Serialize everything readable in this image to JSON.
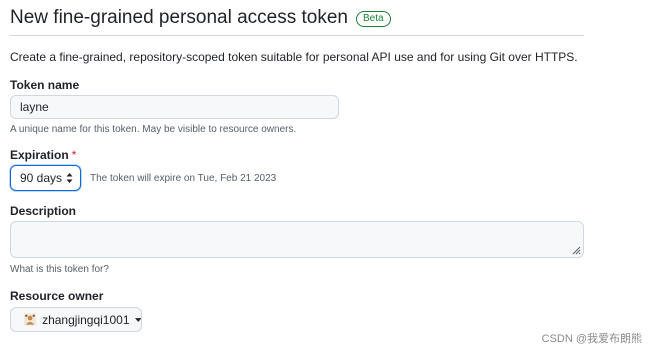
{
  "header": {
    "title": "New fine-grained personal access token",
    "badge": "Beta"
  },
  "intro": "Create a fine-grained, repository-scoped token suitable for personal API use and for using Git over HTTPS.",
  "token_name": {
    "label": "Token name",
    "value": "layne",
    "note": "A unique name for this token. May be visible to resource owners."
  },
  "expiration": {
    "label": "Expiration",
    "required_mark": "*",
    "selected": "90 days",
    "note": "The token will expire on Tue, Feb 21 2023"
  },
  "description": {
    "label": "Description",
    "value": "",
    "note": "What is this token for?"
  },
  "resource_owner": {
    "label": "Resource owner",
    "selected": "zhangjingqi1001",
    "avatar_icon": "user-avatar-icon"
  },
  "watermark": "CSDN @我爱布朗熊",
  "colors": {
    "accent": "#0969da",
    "required": "#cf222e",
    "success": "#1a7f37",
    "border": "#d0d7de"
  }
}
